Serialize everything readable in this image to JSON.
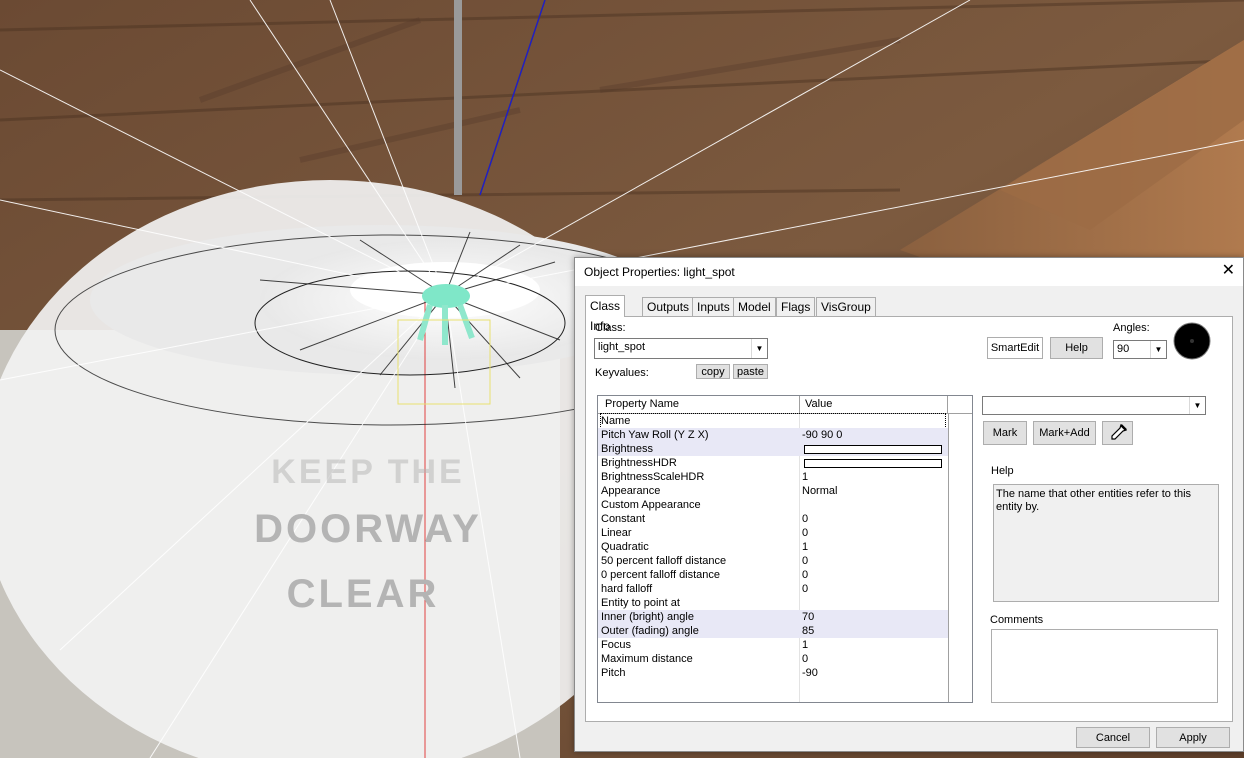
{
  "dialog": {
    "title": "Object Properties: light_spot",
    "close_glyph": "✕",
    "tabs": [
      {
        "label": "Class Info"
      },
      {
        "label": "Outputs"
      },
      {
        "label": "Inputs"
      },
      {
        "label": "Model"
      },
      {
        "label": "Flags"
      },
      {
        "label": "VisGroup"
      }
    ],
    "class_label": "Class:",
    "class_value": "light_spot",
    "keyvalues_label": "Keyvalues:",
    "copy_label": "copy",
    "paste_label": "paste",
    "smartedit_label": "SmartEdit",
    "help_button_label": "Help",
    "angles_label": "Angles:",
    "angles_value": "90",
    "grid": {
      "col_name": "Property Name",
      "col_value": "Value",
      "rows": [
        {
          "name": "Name",
          "value": "",
          "hl": false
        },
        {
          "name": "Pitch Yaw Roll (Y Z X)",
          "value": "-90 90 0",
          "hl": true
        },
        {
          "name": "Brightness",
          "value": "",
          "hl": true,
          "bar": true
        },
        {
          "name": "BrightnessHDR",
          "value": "",
          "hl": false,
          "bar": true
        },
        {
          "name": "BrightnessScaleHDR",
          "value": "1",
          "hl": false
        },
        {
          "name": "Appearance",
          "value": "Normal",
          "hl": false
        },
        {
          "name": "Custom Appearance",
          "value": "",
          "hl": false
        },
        {
          "name": "Constant",
          "value": "0",
          "hl": false
        },
        {
          "name": "Linear",
          "value": "0",
          "hl": false
        },
        {
          "name": "Quadratic",
          "value": "1",
          "hl": false
        },
        {
          "name": "50 percent falloff distance",
          "value": "0",
          "hl": false
        },
        {
          "name": "0 percent falloff distance",
          "value": "0",
          "hl": false
        },
        {
          "name": "hard falloff",
          "value": "0",
          "hl": false
        },
        {
          "name": "Entity to point at",
          "value": "",
          "hl": false
        },
        {
          "name": "Inner (bright) angle",
          "value": "70",
          "hl": true
        },
        {
          "name": "Outer (fading) angle",
          "value": "85",
          "hl": true
        },
        {
          "name": "Focus",
          "value": "1",
          "hl": false
        },
        {
          "name": "Maximum distance",
          "value": "0",
          "hl": false
        },
        {
          "name": "Pitch",
          "value": "-90",
          "hl": false
        }
      ]
    },
    "value_combo": "",
    "mark_label": "Mark",
    "markadd_label": "Mark+Add",
    "help_section_label": "Help",
    "help_text": "The name that other entities refer to this entity by.",
    "comments_label": "Comments",
    "cancel_label": "Cancel",
    "apply_label": "Apply"
  },
  "viewport": {
    "sign_lines": [
      "KEEP THE",
      "DOORWAY",
      "CLEAR"
    ]
  }
}
